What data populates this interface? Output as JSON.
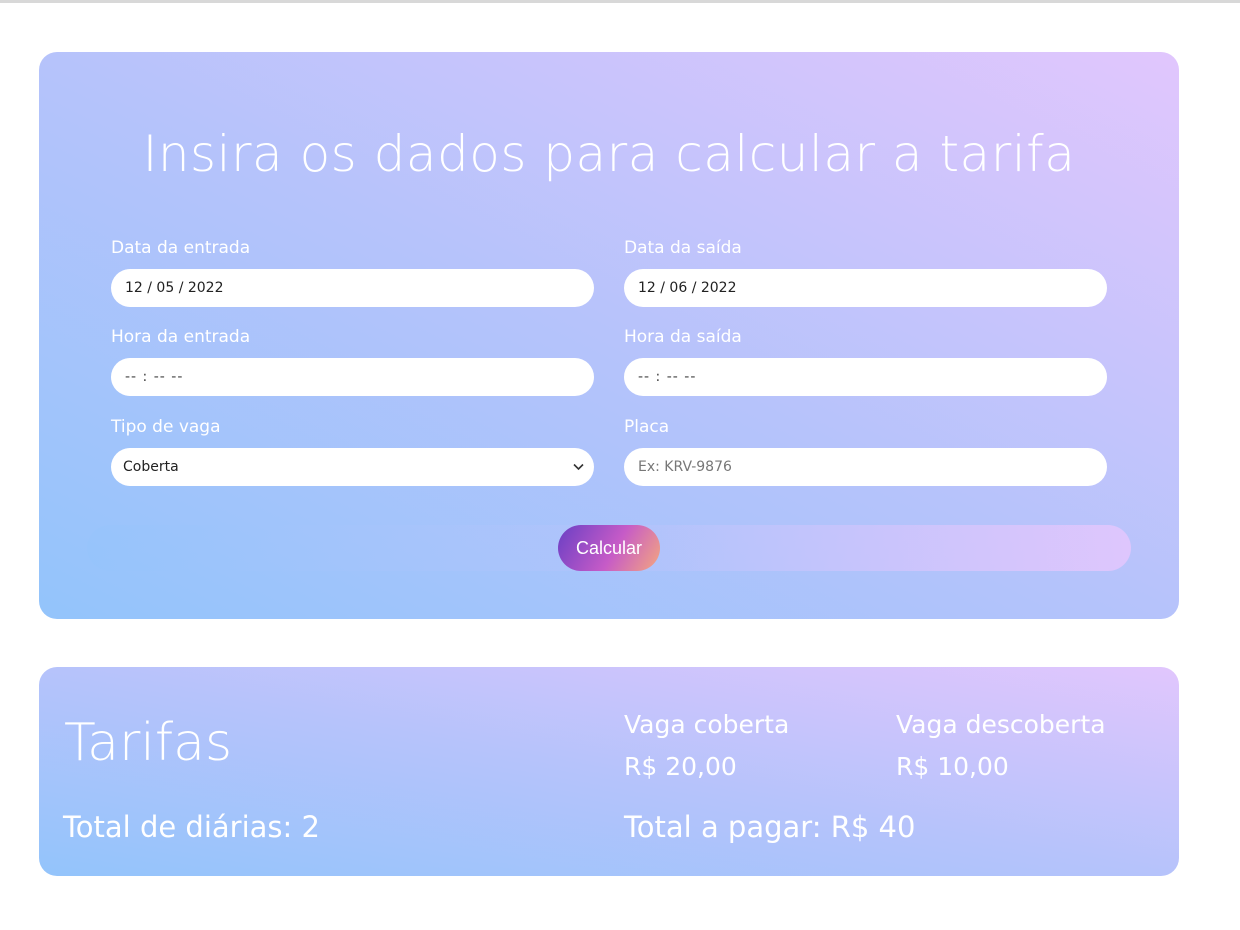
{
  "form": {
    "title": "Insira os dados para calcular a tarifa",
    "entry_date": {
      "label": "Data da entrada",
      "value": "12 / 05 / 2022"
    },
    "exit_date": {
      "label": "Data da saída",
      "value": "12 / 06 / 2022"
    },
    "entry_time": {
      "label": "Hora da entrada",
      "value": "-- : --  --"
    },
    "exit_time": {
      "label": "Hora da saída",
      "value": "-- : --  --"
    },
    "spot_type": {
      "label": "Tipo de vaga",
      "selected": "Coberta"
    },
    "plate": {
      "label": "Placa",
      "placeholder": "Ex: KRV-9876"
    },
    "submit_label": "Calcular"
  },
  "tariffs": {
    "title": "Tarifas",
    "covered": {
      "name": "Vaga coberta",
      "price": "R$ 20,00"
    },
    "uncovered": {
      "name": "Vaga descoberta",
      "price": "R$ 10,00"
    },
    "total_days": "Total de diárias: 2",
    "total_pay": "Total a pagar: R$ 40"
  },
  "colors": {
    "gradient_start": "#93c4fb",
    "gradient_end": "#e1c6fd",
    "button_gradient": [
      "#6a3fc4",
      "#c65bc7",
      "#f4a77e"
    ]
  },
  "icons": {
    "select_chevron": "chevron-down-icon"
  }
}
